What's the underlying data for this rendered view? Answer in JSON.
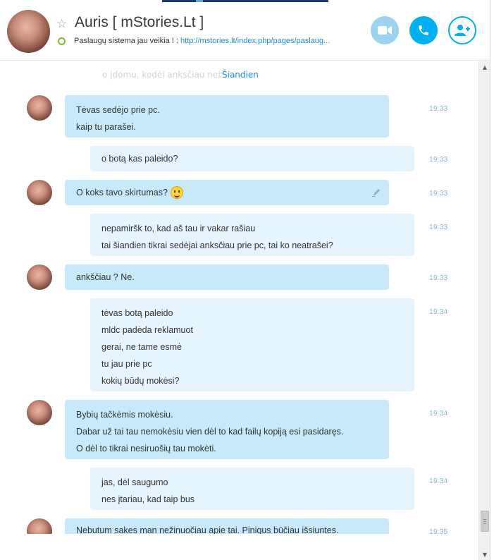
{
  "header": {
    "title": "Auris [ mStories.Lt ]",
    "mood_text": "Paslaugų sistema jau veikia ! :",
    "mood_link": "http://mstories.lt/index.php/pages/paslaug...",
    "presence_color": "#7cbf2f",
    "accent": "#00aff0",
    "icons": [
      "favorite-star-icon",
      "video-call-icon",
      "phone-icon",
      "add-contact-icon"
    ]
  },
  "chat": {
    "ghost_text": "o įdomu, kodėl anksčiau nebū",
    "day_label": "Šiandien",
    "messages": [
      {
        "from": "them",
        "lines": [
          "Tėvas sedėjo prie pc.",
          "kaip tu parašei."
        ],
        "time": "19:33"
      },
      {
        "from": "me",
        "lines": [
          "o botą kas paleido?"
        ],
        "time": "19:33"
      },
      {
        "from": "them",
        "lines": [
          "O koks tavo skirtumas?"
        ],
        "time": "19:33",
        "emoji": "smile-emoji",
        "edited": true
      },
      {
        "from": "me",
        "lines": [
          "nepamiršk to, kad aš tau ir vakar rašiau",
          "tai šiandien tikrai sedėjai anksčiau prie pc, tai ko neatrašei?"
        ],
        "time": "19:33"
      },
      {
        "from": "them",
        "lines": [
          "ankščiau ? Ne."
        ],
        "time": "19:33"
      },
      {
        "from": "me",
        "lines": [
          "tėvas botą paleido",
          "mldc padėda reklamuot",
          "gerai, ne tame esmė",
          "tu jau prie pc",
          "kokių būdų mokėsi?"
        ],
        "time": "19:34"
      },
      {
        "from": "them",
        "lines": [
          "Bybių tačkėmis mokėsiu.",
          "Dabar už tai tau nemokėsiu vien dėl to kad failų kopiją esi pasidaręs.",
          "O dėl to tikrai nesiruošių tau mokėti."
        ],
        "time": "19:34"
      },
      {
        "from": "me",
        "lines": [
          "jas, dėl saugumo",
          "nes įtariau, kad taip bus"
        ],
        "time": "19:34"
      },
      {
        "from": "them",
        "lines": [
          "Nebutum sakes man nežinuočiau apie tai. Pinigus būčiau išsiuntes."
        ],
        "time": "19:35"
      }
    ]
  }
}
